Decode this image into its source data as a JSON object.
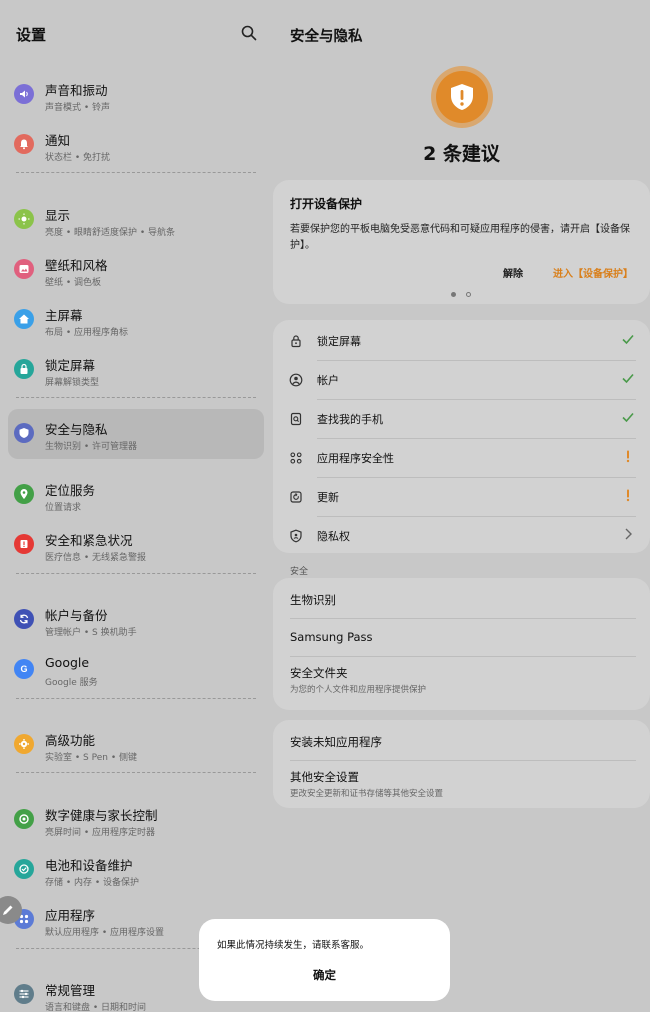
{
  "left": {
    "title": "设置",
    "items": [
      {
        "title": "声音和振动",
        "sub": "声音模式 • 铃声",
        "color": "#7b6fd6",
        "icon": "speaker-icon"
      },
      {
        "title": "通知",
        "sub": "状态栏 • 免打扰",
        "color": "#e26a5e",
        "icon": "bell-icon"
      },
      {
        "title": "显示",
        "sub": "亮度 • 眼睛舒适度保护 • 导航条",
        "color": "#8bc34a",
        "icon": "sun-icon"
      },
      {
        "title": "壁纸和风格",
        "sub": "壁纸 • 调色板",
        "color": "#e0607e",
        "icon": "image-icon"
      },
      {
        "title": "主屏幕",
        "sub": "布局 • 应用程序角标",
        "color": "#3aa0e8",
        "icon": "home-icon"
      },
      {
        "title": "锁定屏幕",
        "sub": "屏幕解锁类型",
        "color": "#26a69a",
        "icon": "lock-icon"
      },
      {
        "title": "安全与隐私",
        "sub": "生物识别 • 许可管理器",
        "color": "#5c6bc0",
        "icon": "shield-icon"
      },
      {
        "title": "定位服务",
        "sub": "位置请求",
        "color": "#43a047",
        "icon": "location-pin-icon"
      },
      {
        "title": "安全和紧急状况",
        "sub": "医疗信息 • 无线紧急警报",
        "color": "#e53935",
        "icon": "emergency-icon"
      },
      {
        "title": "帐户与备份",
        "sub": "管理帐户 • S 换机助手",
        "color": "#3f51b5",
        "icon": "sync-icon"
      },
      {
        "title": "Google",
        "sub": "Google 服务",
        "color": "#4285f4",
        "icon": "google-icon"
      },
      {
        "title": "高级功能",
        "sub": "实验室 • S Pen • 侧键",
        "color": "#f0a830",
        "icon": "gear-plus-icon"
      },
      {
        "title": "数字健康与家长控制",
        "sub": "亮屏时间 • 应用程序定时器",
        "color": "#43a047",
        "icon": "wellbeing-icon"
      },
      {
        "title": "电池和设备维护",
        "sub": "存储 • 内存 • 设备保护",
        "color": "#26a69a",
        "icon": "battery-care-icon"
      },
      {
        "title": "应用程序",
        "sub": "默认应用程序 • 应用程序设置",
        "color": "#5c7bd6",
        "icon": "apps-grid-icon"
      },
      {
        "title": "常规管理",
        "sub": "语言和键盘 • 日期和时间",
        "color": "#607d8b",
        "icon": "sliders-icon"
      }
    ]
  },
  "right": {
    "title": "安全与隐私",
    "suggest_count": "2 条建议",
    "tip": {
      "title": "打开设备保护",
      "body": "若要保护您的平板电脑免受恶意代码和可疑应用程序的侵害，请开启【设备保护】。",
      "dismiss": "解除",
      "enter": "进入【设备保护】"
    },
    "checks": [
      {
        "label": "锁定屏幕",
        "status": "ok",
        "icon": "lock-icon"
      },
      {
        "label": "帐户",
        "status": "ok",
        "icon": "account-icon"
      },
      {
        "label": "查找我的手机",
        "status": "ok",
        "icon": "find-phone-icon"
      },
      {
        "label": "应用程序安全性",
        "status": "warn",
        "icon": "app-security-icon"
      },
      {
        "label": "更新",
        "status": "warn",
        "icon": "update-icon"
      },
      {
        "label": "隐私权",
        "status": "more",
        "icon": "privacy-icon"
      }
    ],
    "section_label": "安全",
    "security_items": [
      {
        "title": "生物识别",
        "sub": ""
      },
      {
        "title": "Samsung Pass",
        "sub": ""
      },
      {
        "title": "安全文件夹",
        "sub": "为您的个人文件和应用程序提供保护"
      }
    ],
    "other_items": [
      {
        "title": "安装未知应用程序",
        "sub": ""
      },
      {
        "title": "其他安全设置",
        "sub": "更改安全更新和证书存储等其他安全设置"
      }
    ]
  },
  "dialog": {
    "message": "如果此情况持续发生，请联系客服。",
    "ok": "确定"
  },
  "colors": {
    "ok": "#4a9a4a",
    "warn": "#e08a2a",
    "accent": "#d97f1a"
  }
}
